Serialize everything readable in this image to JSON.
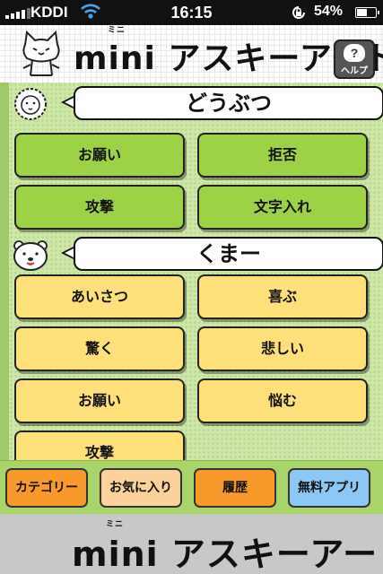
{
  "status": {
    "carrier": "KDDI",
    "time": "16:15",
    "battery_pct": "54%",
    "battery_level": 0.54,
    "icons": [
      "signal-icon",
      "wifi-icon",
      "rotation-lock-icon",
      "battery-icon"
    ]
  },
  "header": {
    "logo_main": "mini アスキーアート",
    "logo_ruby": "ミニ",
    "help_label": "ヘルプ",
    "help_glyph": "?"
  },
  "sections": [
    {
      "title": "どうぶつ",
      "buttons": [
        "お願い",
        "拒否",
        "攻撃",
        "文字入れ"
      ]
    },
    {
      "title": "くまー",
      "buttons": [
        "あいさつ",
        "喜ぶ",
        "驚く",
        "悲しい",
        "お願い",
        "悩む",
        "攻撃"
      ]
    }
  ],
  "tabs": [
    "カテゴリー",
    "お気に入り",
    "履歴",
    "無料アプリ"
  ],
  "footer": {
    "logo_main": "mini アスキーアート",
    "logo_ruby": "ミニ"
  },
  "colors": {
    "green_button": "#9ed246",
    "yellow_button": "#fee07a",
    "tab_orange": "#f79a2b",
    "tab_light": "#fbd29c",
    "tab_blue": "#8cc8f3"
  }
}
